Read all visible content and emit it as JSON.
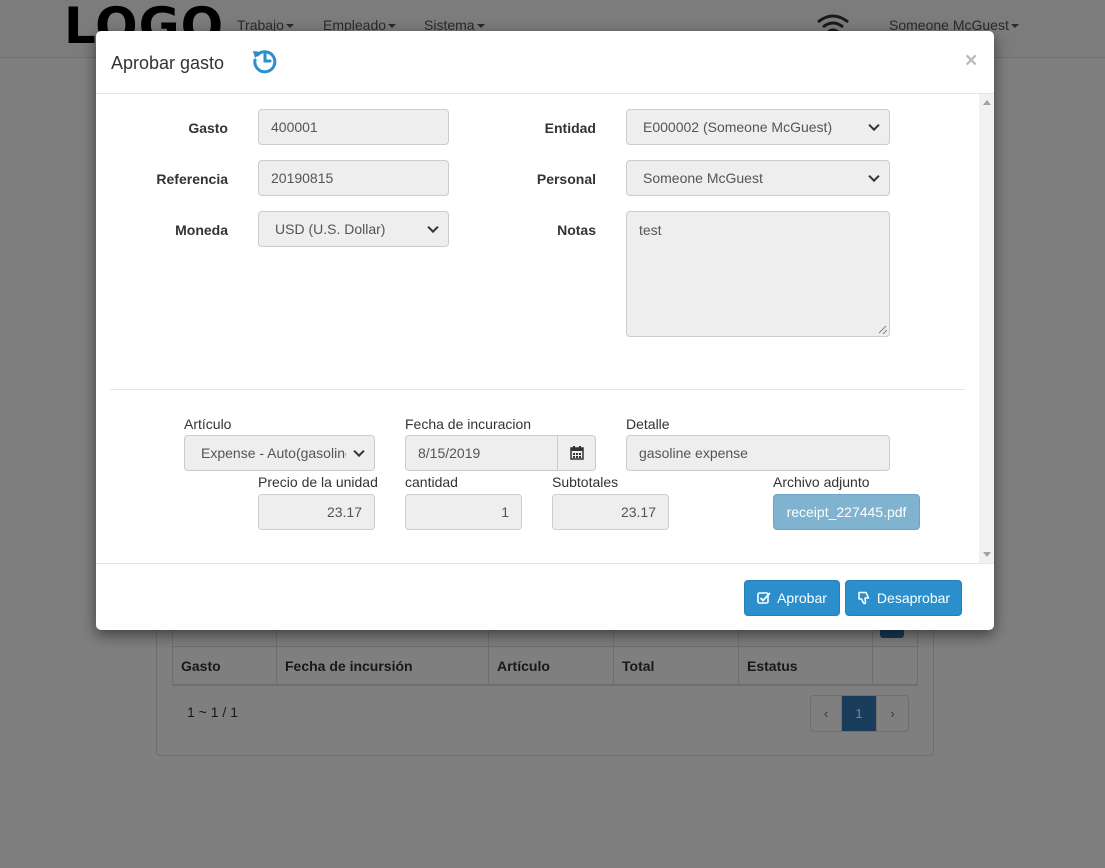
{
  "navbar": {
    "logo": "LOGO",
    "menus": [
      "Trabajo",
      "Empleado",
      "Sistema"
    ],
    "user": "Someone McGuest",
    "wifi_icon": "wifi-icon"
  },
  "background": {
    "table_headers": [
      "Gasto",
      "Fecha de incursión",
      "Artículo",
      "Total",
      "Estatus",
      ""
    ],
    "paging_info": "1 ~ 1 / 1",
    "pagination": {
      "prev": "‹",
      "current": "1",
      "next": "›"
    }
  },
  "modal": {
    "title": "Aprobar gasto",
    "history_icon": "history-icon",
    "close_label": "×",
    "fields": {
      "gasto": {
        "label": "Gasto",
        "value": "400001"
      },
      "referencia": {
        "label": "Referencia",
        "value": "20190815"
      },
      "moneda": {
        "label": "Moneda",
        "value": "USD (U.S. Dollar)"
      },
      "entidad": {
        "label": "Entidad",
        "value": "E000002 (Someone McGuest)"
      },
      "personal": {
        "label": "Personal",
        "value": "Someone McGuest"
      },
      "notas": {
        "label": "Notas",
        "value": "test"
      }
    },
    "item": {
      "articulo": {
        "label": "Artículo",
        "value": "Expense - Auto(gasoline"
      },
      "fecha": {
        "label": "Fecha de incuracion",
        "value": "8/15/2019"
      },
      "detalle": {
        "label": "Detalle",
        "value": "gasoline expense"
      },
      "precio": {
        "label": "Precio de la unidad",
        "value": "23.17"
      },
      "cantidad": {
        "label": "cantidad",
        "value": "1"
      },
      "subtotales": {
        "label": "Subtotales",
        "value": "23.17"
      },
      "adjunto": {
        "label": "Archivo adjunto",
        "value": "receipt_227445.pdf"
      }
    },
    "footer": {
      "approve_label": "Aprobar",
      "disapprove_label": "Desaprobar"
    }
  },
  "colors": {
    "primary_button": "#2a8fcc",
    "attachment_button": "#7fb3d0",
    "icon_blue": "#2a8fcc"
  }
}
